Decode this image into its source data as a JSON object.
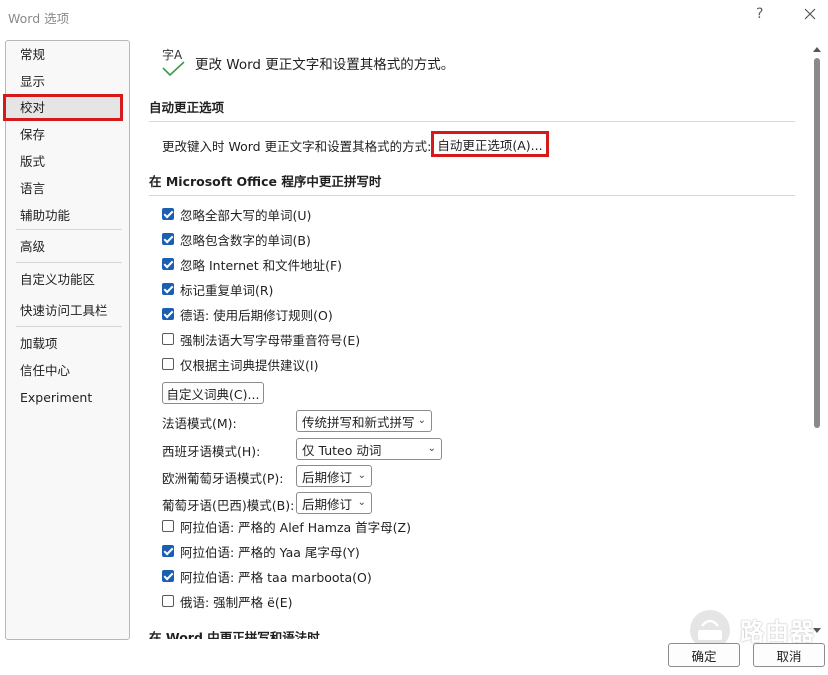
{
  "window": {
    "title": "Word 选项",
    "help_glyph": "?",
    "close_icon": "close-icon"
  },
  "sidebar": {
    "items": [
      {
        "label": "常规"
      },
      {
        "label": "显示"
      },
      {
        "label": "校对",
        "selected": true
      },
      {
        "label": "保存"
      },
      {
        "label": "版式"
      },
      {
        "label": "语言"
      },
      {
        "label": "辅助功能"
      },
      {
        "label": "高级"
      },
      {
        "label": "自定义功能区"
      },
      {
        "label": "快速访问工具栏"
      },
      {
        "label": "加载项"
      },
      {
        "label": "信任中心"
      },
      {
        "label": "Experiment"
      }
    ]
  },
  "header": {
    "icon": "proofing-abc-check-icon",
    "icon_text": "字A",
    "text": "更改 Word 更正文字和设置其格式的方式。"
  },
  "autocorrect": {
    "heading": "自动更正选项",
    "label": "更改键入时 Word 更正文字和设置其格式的方式:",
    "button": "自动更正选项(A)..."
  },
  "office_spelling": {
    "heading": "在 Microsoft Office 程序中更正拼写时",
    "checkboxes": [
      {
        "label": "忽略全部大写的单词(U)",
        "checked": true
      },
      {
        "label": "忽略包含数字的单词(B)",
        "checked": true
      },
      {
        "label": "忽略 Internet 和文件地址(F)",
        "checked": true
      },
      {
        "label": "标记重复单词(R)",
        "checked": true
      },
      {
        "label": "德语: 使用后期修订规则(O)",
        "checked": true
      },
      {
        "label": "强制法语大写字母带重音符号(E)",
        "checked": false
      },
      {
        "label": "仅根据主词典提供建议(I)",
        "checked": false
      }
    ],
    "custom_dict_button": "自定义词典(C)...",
    "modes": [
      {
        "label": "法语模式(M):",
        "value": "传统拼写和新式拼写"
      },
      {
        "label": "西班牙语模式(H):",
        "value": "仅 Tuteo 动词"
      },
      {
        "label": "欧洲葡萄牙语模式(P):",
        "value": "后期修订"
      },
      {
        "label": "葡萄牙语(巴西)模式(B):",
        "value": "后期修订"
      }
    ],
    "arabic_checkboxes": [
      {
        "label": "阿拉伯语: 严格的 Alef Hamza 首字母(Z)",
        "checked": false
      },
      {
        "label": "阿拉伯语: 严格的 Yaa 尾字母(Y)",
        "checked": true
      },
      {
        "label": "阿拉伯语: 严格 taa marboota(O)",
        "checked": true
      },
      {
        "label": "俄语: 强制严格 ë(E)",
        "checked": false
      }
    ]
  },
  "word_spelling": {
    "heading": "在 Word 中更正拼写和语法时"
  },
  "footer": {
    "ok": "确定",
    "cancel": "取消"
  },
  "watermark": {
    "text": "路由器"
  },
  "colors": {
    "accent": "#1a5fb4",
    "highlight_border": "#d41a1a",
    "selected_bg": "#e5e5e5"
  }
}
